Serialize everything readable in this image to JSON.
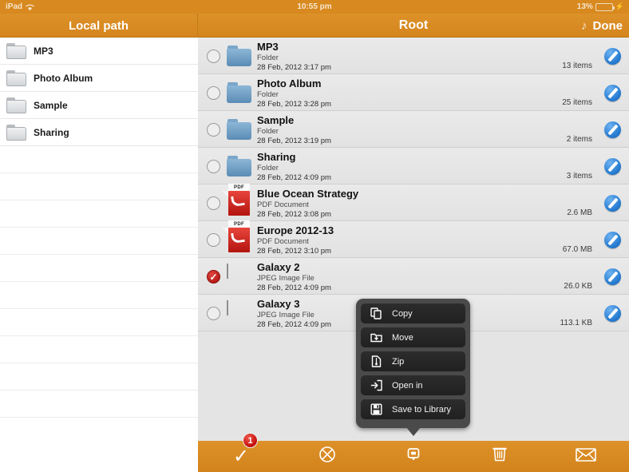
{
  "status_bar": {
    "device": "iPad",
    "wifi_icon": "wifi-icon",
    "time": "10:55 pm",
    "battery_percent": "13%",
    "battery_level": 13,
    "charging_icon": "lightning-bolt-icon"
  },
  "nav": {
    "left_title": "Local path",
    "title": "Root",
    "music_icon": "music-note-icon",
    "done_label": "Done"
  },
  "sidebar": {
    "items": [
      {
        "label": "MP3",
        "icon": "folder-icon"
      },
      {
        "label": "Photo Album",
        "icon": "folder-icon"
      },
      {
        "label": "Sample",
        "icon": "folder-icon"
      },
      {
        "label": "Sharing",
        "icon": "folder-icon"
      }
    ],
    "empty_rows": 10
  },
  "file_list": {
    "rows": [
      {
        "name": "MP3",
        "type": "Folder",
        "date": "28 Feb, 2012 3:17 pm",
        "meta": "13 items",
        "icon": "folder-icon",
        "selected": false
      },
      {
        "name": "Photo Album",
        "type": "Folder",
        "date": "28 Feb, 2012 3:28 pm",
        "meta": "25 items",
        "icon": "folder-icon",
        "selected": false
      },
      {
        "name": "Sample",
        "type": "Folder",
        "date": "28 Feb, 2012 3:19 pm",
        "meta": "2 items",
        "icon": "folder-icon",
        "selected": false
      },
      {
        "name": "Sharing",
        "type": "Folder",
        "date": "28 Feb, 2012 4:09 pm",
        "meta": "3 items",
        "icon": "folder-icon",
        "selected": false
      },
      {
        "name": "Blue Ocean Strategy",
        "type": "PDF Document",
        "date": "28 Feb, 2012 3:08 pm",
        "meta": "2.6 MB",
        "icon": "pdf-icon",
        "icon_label": "PDF",
        "selected": false
      },
      {
        "name": "Europe 2012-13",
        "type": "PDF Document",
        "date": "28 Feb, 2012 3:10 pm",
        "meta": "67.0 MB",
        "icon": "pdf-icon",
        "icon_label": "PDF",
        "selected": false
      },
      {
        "name": "Galaxy 2",
        "type": "JPEG Image File",
        "date": "28 Feb, 2012 4:09 pm",
        "meta": "26.0 KB",
        "icon": "image-thumbnail",
        "selected": true
      },
      {
        "name": "Galaxy 3",
        "type": "JPEG Image File",
        "date": "28 Feb, 2012 4:09 pm",
        "meta": "113.1 KB",
        "icon": "image-thumbnail",
        "selected": false
      }
    ],
    "edit_button_icon": "pencil-edit-icon"
  },
  "popover_menu": {
    "items": [
      {
        "label": "Copy",
        "icon": "copy-icon"
      },
      {
        "label": "Move",
        "icon": "move-folder-icon"
      },
      {
        "label": "Zip",
        "icon": "zip-file-icon"
      },
      {
        "label": "Open in",
        "icon": "open-in-icon"
      },
      {
        "label": "Save to Library",
        "icon": "save-disk-icon"
      }
    ]
  },
  "toolbar": {
    "buttons": [
      {
        "name": "select-all",
        "icon": "checkmark-icon",
        "badge": "1"
      },
      {
        "name": "deselect-all",
        "icon": "circle-slash-icon"
      },
      {
        "name": "actions",
        "icon": "action-popover-icon"
      },
      {
        "name": "delete",
        "icon": "trash-icon"
      },
      {
        "name": "email",
        "icon": "envelope-icon"
      }
    ]
  },
  "colors": {
    "accent_orange": "#d8891f",
    "list_background": "#e4e4e4",
    "selected_red": "#c4100d",
    "edit_blue": "#2a7fd4",
    "folder_blue": "#6f9fc6",
    "pdf_red": "#c91d16"
  }
}
